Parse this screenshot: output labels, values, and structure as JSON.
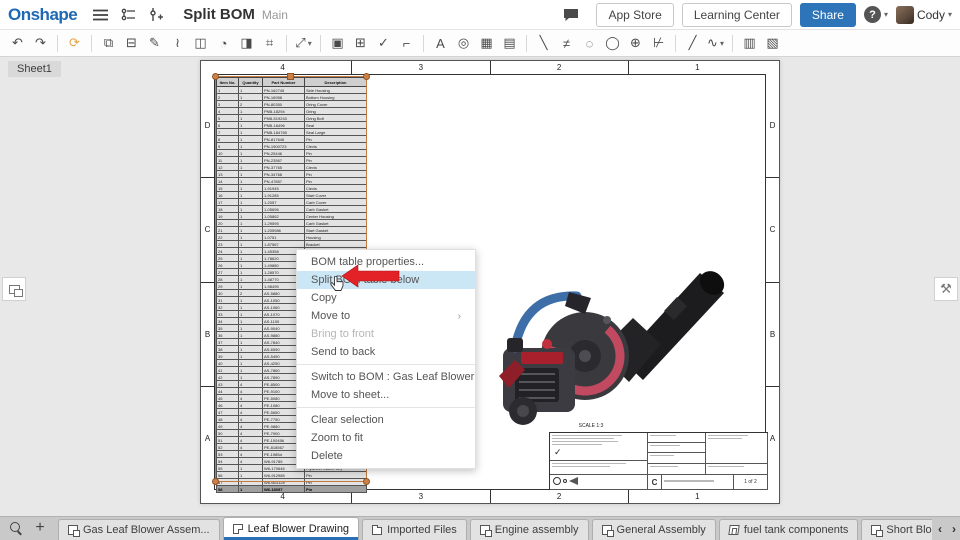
{
  "topbar": {
    "logo": "Onshape",
    "title": "Split BOM",
    "workspace": "Main",
    "app_store": "App Store",
    "learning_center": "Learning Center",
    "share": "Share",
    "user": "Cody"
  },
  "icons": {
    "hamburger-icon": "3 horizontal bars",
    "versions-icon": "branch graph",
    "follow-icon": "slider with plus",
    "comment-icon": "speech bubble",
    "help-icon": "?",
    "wrench-icon": "⚒",
    "sheets-panel-icon": "stacked pages"
  },
  "toolbar": {
    "groups": [
      [
        {
          "name": "undo-icon",
          "glyph": "↶"
        },
        {
          "name": "redo-icon",
          "glyph": "↷"
        }
      ],
      [
        {
          "name": "update-icon",
          "glyph": "⟳",
          "accent": true
        }
      ],
      [
        {
          "name": "insert-view-icon",
          "glyph": "⧉"
        },
        {
          "name": "view-properties-icon",
          "glyph": "⊟"
        },
        {
          "name": "show-hidden-edges-icon",
          "glyph": "✎"
        },
        {
          "name": "broken-view-icon",
          "glyph": "≀"
        },
        {
          "name": "section-view-icon",
          "glyph": "◫"
        },
        {
          "name": "auxiliary-view-icon",
          "glyph": "◔"
        },
        {
          "name": "crosshatch-icon",
          "glyph": "◨"
        },
        {
          "name": "crop-view-icon",
          "glyph": "⌗"
        }
      ],
      [
        {
          "name": "dimension-icon",
          "glyph": "⤢",
          "caret": true
        }
      ],
      [
        {
          "name": "note-icon",
          "glyph": "▣"
        },
        {
          "name": "hole-table-icon",
          "glyph": "⊞"
        },
        {
          "name": "finish-mark-icon",
          "glyph": "✓"
        },
        {
          "name": "weld-symbol-icon",
          "glyph": "⌐"
        }
      ],
      [
        {
          "name": "text-icon",
          "glyph": "A"
        },
        {
          "name": "detail-circle-icon",
          "glyph": "◎"
        },
        {
          "name": "table-icon",
          "glyph": "▦"
        },
        {
          "name": "bom-table-icon",
          "glyph": "▤"
        }
      ],
      [
        {
          "name": "callout-icon",
          "glyph": "╲"
        },
        {
          "name": "centerline-icon",
          "glyph": "≠"
        },
        {
          "name": "centermark-icon",
          "glyph": "◌"
        },
        {
          "name": "circle-tool-icon",
          "glyph": "◯"
        },
        {
          "name": "point-icon",
          "glyph": "⊕"
        },
        {
          "name": "tangent-line-icon",
          "glyph": "⊬"
        }
      ],
      [
        {
          "name": "line-icon",
          "glyph": "╱"
        },
        {
          "name": "spline-icon",
          "glyph": "∿",
          "caret": true
        }
      ],
      [
        {
          "name": "export-dxf-icon",
          "glyph": "▥"
        },
        {
          "name": "insert-image-icon",
          "glyph": "▧"
        }
      ]
    ]
  },
  "sheet": {
    "name": "Sheet1",
    "zones_top": [
      "4",
      "3",
      "2",
      "1"
    ],
    "zones_bottom": [
      "4",
      "3",
      "2",
      "1"
    ],
    "zones_left": [
      "D",
      "C",
      "B",
      "A"
    ],
    "zones_right": [
      "D",
      "C",
      "B",
      "A"
    ],
    "scale_label": "SCALE 1:3",
    "titleblock": {
      "size": "C",
      "sheet_count": "1 of 2"
    }
  },
  "bom": {
    "headers": [
      "Item No.",
      "Quantity",
      "Part Number",
      "Description"
    ],
    "rows": [
      [
        "1",
        "1",
        "PN-162745",
        "Side Housing"
      ],
      [
        "2",
        "1",
        "PN-16958",
        "Bottom Housing"
      ],
      [
        "3",
        "2",
        "PN-80350",
        "Oring Cover"
      ],
      [
        "4",
        "1",
        "PNB-18294",
        "Oring"
      ],
      [
        "5",
        "1",
        "PNB-519243",
        "Oring Bolt"
      ],
      [
        "6",
        "1",
        "PNB-18496",
        "Seal"
      ],
      [
        "7",
        "1",
        "PNB-184765",
        "Seal Large"
      ],
      [
        "8",
        "1",
        "PN-817646",
        "Pin"
      ],
      [
        "9",
        "1",
        "PN-1900723",
        "Clevis"
      ],
      [
        "10",
        "1",
        "PN-25446",
        "Pin"
      ],
      [
        "11",
        "1",
        "PN-23567",
        "Pin"
      ],
      [
        "12",
        "1",
        "PN-37765",
        "Clevis"
      ],
      [
        "13",
        "1",
        "PN-34768",
        "Pin"
      ],
      [
        "14",
        "1",
        "PN-47857",
        "Pin"
      ],
      [
        "15",
        "1",
        "1-91945",
        "Clevis"
      ],
      [
        "16",
        "1",
        "1-91285",
        "Start Cover"
      ],
      [
        "17",
        "1",
        "1-2057",
        "Carb Cover"
      ],
      [
        "18",
        "1",
        "1-05696",
        "Carb Gasket"
      ],
      [
        "19",
        "1",
        "1-05862",
        "Center Housing"
      ],
      [
        "20",
        "1",
        "1-29595",
        "Carb Gasket"
      ],
      [
        "21",
        "1",
        "1-205986",
        "Start Gasket"
      ],
      [
        "22",
        "1",
        "1-0751",
        "Housing"
      ],
      [
        "23",
        "1",
        "1-87567",
        "Bracket"
      ],
      [
        "24",
        "1",
        "1-45358",
        ""
      ],
      [
        "25",
        "1",
        "1-78620",
        ""
      ],
      [
        "26",
        "1",
        "1-49880",
        ""
      ],
      [
        "27",
        "1",
        "1-28570",
        ""
      ],
      [
        "28",
        "1",
        "1-48770",
        ""
      ],
      [
        "29",
        "1",
        "1-98495",
        ""
      ],
      [
        "30",
        "2",
        "AS-5880",
        ""
      ],
      [
        "31",
        "1",
        "AS-1050",
        ""
      ],
      [
        "32",
        "1",
        "AS-1060",
        ""
      ],
      [
        "33",
        "1",
        "AS-1070",
        ""
      ],
      [
        "34",
        "1",
        "AS-1100",
        ""
      ],
      [
        "35",
        "1",
        "AS-9040",
        ""
      ],
      [
        "36",
        "1",
        "AS-9880",
        ""
      ],
      [
        "37",
        "1",
        "AS-7840",
        ""
      ],
      [
        "38",
        "1",
        "AS-6590",
        ""
      ],
      [
        "39",
        "1",
        "AS-5490",
        ""
      ],
      [
        "40",
        "1",
        "AS-4250",
        ""
      ],
      [
        "41",
        "1",
        "AS-7860",
        ""
      ],
      [
        "42",
        "1",
        "AS-7890",
        ""
      ],
      [
        "43",
        "4",
        "PE-8500",
        ""
      ],
      [
        "44",
        "4",
        "PE-9100",
        ""
      ],
      [
        "45",
        "4",
        "PE-5080",
        ""
      ],
      [
        "46",
        "4",
        "PE-1080",
        ""
      ],
      [
        "47",
        "4",
        "PE-5650",
        ""
      ],
      [
        "48",
        "4",
        "PE-7750",
        ""
      ],
      [
        "49",
        "4",
        "PE-9880",
        ""
      ],
      [
        "50",
        "4",
        "PE-7900",
        ""
      ],
      [
        "51",
        "4",
        "PE-100456",
        "Vest"
      ],
      [
        "52",
        "4",
        "PE-818567",
        "Pins"
      ],
      [
        "53",
        "4",
        "PE-1985d",
        "Pins"
      ],
      [
        "54",
        "4",
        "W6-91785",
        "Flywheel"
      ],
      [
        "55",
        "1",
        "W6-170646",
        "Flywheel Starter key"
      ],
      [
        "56",
        "1",
        "W6-912985",
        "Pin"
      ],
      [
        "57",
        "1",
        "W6-663128",
        "Pin"
      ],
      [
        "58",
        "1",
        "W6-18057",
        "Pin"
      ]
    ]
  },
  "context_menu": {
    "items": [
      {
        "label": "BOM table properties...",
        "state": "normal"
      },
      {
        "label": "Split BOM table below",
        "state": "highlighted"
      },
      {
        "label": "Copy",
        "state": "normal"
      },
      {
        "label": "Move to",
        "state": "normal",
        "submenu": true
      },
      {
        "label": "Bring to front",
        "state": "disabled"
      },
      {
        "label": "Send to back",
        "state": "normal"
      },
      {
        "label": "Switch to BOM : Gas Leaf Blower Asse...",
        "state": "normal"
      },
      {
        "label": "Move to sheet...",
        "state": "normal"
      },
      {
        "label": "Clear selection",
        "state": "normal"
      },
      {
        "label": "Zoom to fit",
        "state": "normal"
      },
      {
        "label": "Delete",
        "state": "normal"
      }
    ],
    "dividers_after": [
      5,
      7
    ],
    "highlight_color": "#cbe6f5"
  },
  "annotation": {
    "arrow_color": "#e32227"
  },
  "tabbar": {
    "tabs": [
      {
        "label": "Gas Leaf Blower Assem...",
        "icon": "assembly",
        "active": false
      },
      {
        "label": "Leaf Blower Drawing",
        "icon": "drawing",
        "active": true
      },
      {
        "label": "Imported Files",
        "icon": "folder",
        "active": false
      },
      {
        "label": "Engine assembly",
        "icon": "assembly",
        "active": false
      },
      {
        "label": "General Assembly",
        "icon": "assembly",
        "active": false
      },
      {
        "label": "fuel tank components",
        "icon": "part",
        "active": false
      },
      {
        "label": "Short Block Assembly",
        "icon": "assembly",
        "active": false
      }
    ]
  }
}
